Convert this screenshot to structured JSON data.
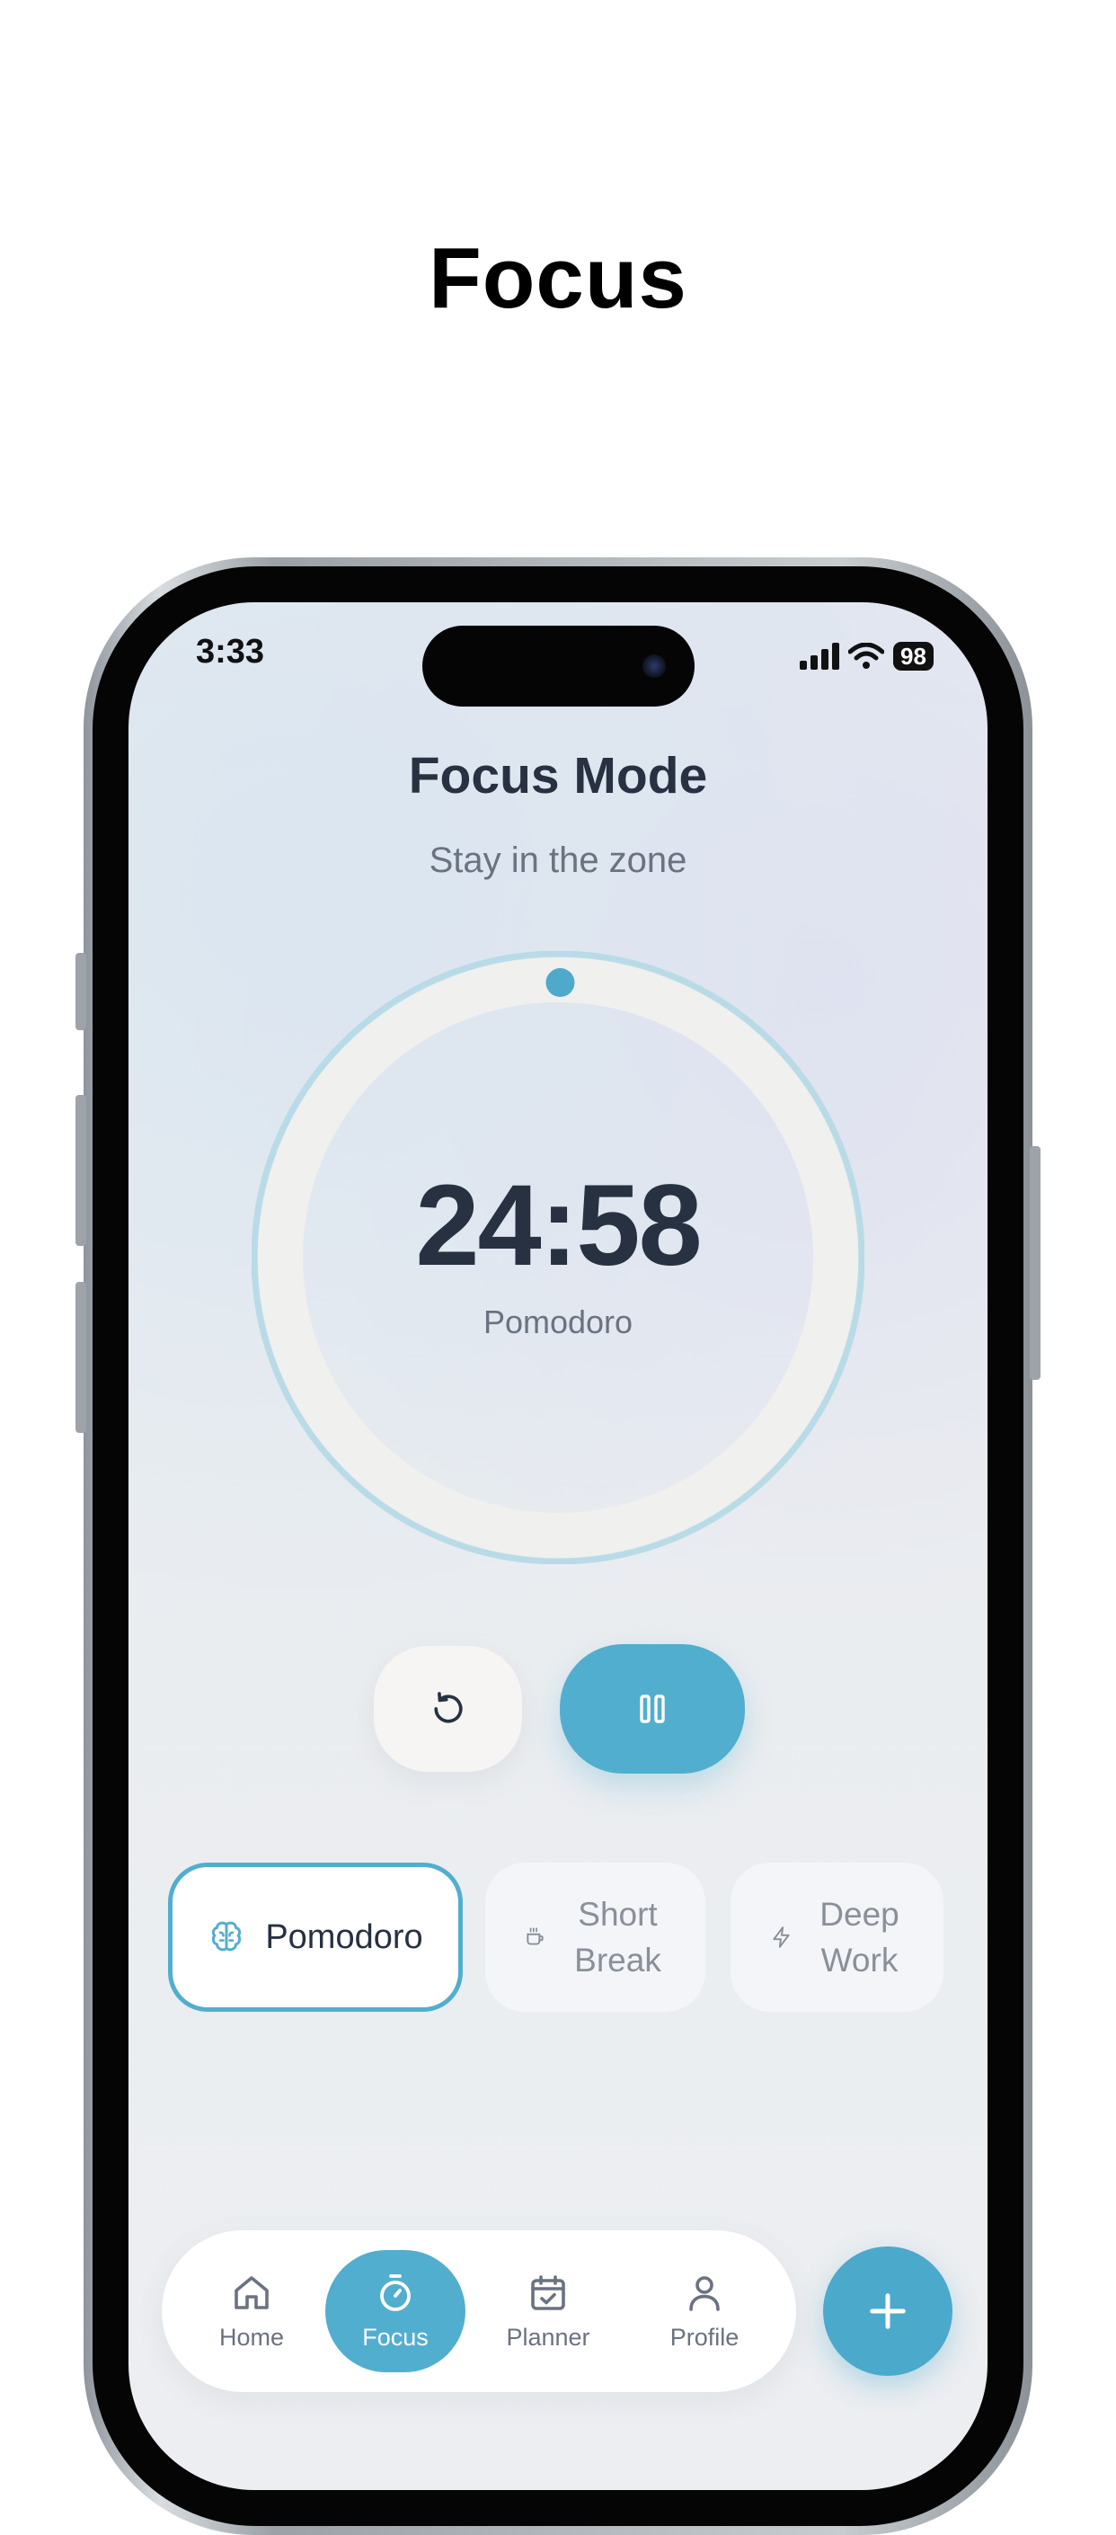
{
  "page": {
    "headline": "Focus"
  },
  "status_bar": {
    "time": "3:33",
    "battery": "98",
    "icons": [
      "signal-icon",
      "wifi-icon",
      "battery-icon"
    ]
  },
  "focus": {
    "title": "Focus Mode",
    "subtitle": "Stay in the zone",
    "timer": {
      "time": "24:58",
      "mode": "Pomodoro",
      "progress": 0.0013
    }
  },
  "controls": {
    "reset_icon": "reset-icon",
    "pause_icon": "pause-icon"
  },
  "presets": [
    {
      "label": "Pomodoro",
      "icon": "brain-icon",
      "active": true
    },
    {
      "label": "Short Break",
      "icon": "coffee-icon",
      "active": false
    },
    {
      "label": "Deep Work",
      "icon": "lightning-icon",
      "active": false
    }
  ],
  "nav": {
    "items": [
      {
        "label": "Home",
        "icon": "home-icon"
      },
      {
        "label": "Focus",
        "icon": "stopwatch-icon"
      },
      {
        "label": "Planner",
        "icon": "calendar-icon"
      },
      {
        "label": "Profile",
        "icon": "profile-icon"
      }
    ],
    "active": "Focus",
    "fab_icon": "plus-icon"
  },
  "colors": {
    "accent": "#52aecf",
    "text_dark": "#273142",
    "text_muted": "#6b7280"
  }
}
